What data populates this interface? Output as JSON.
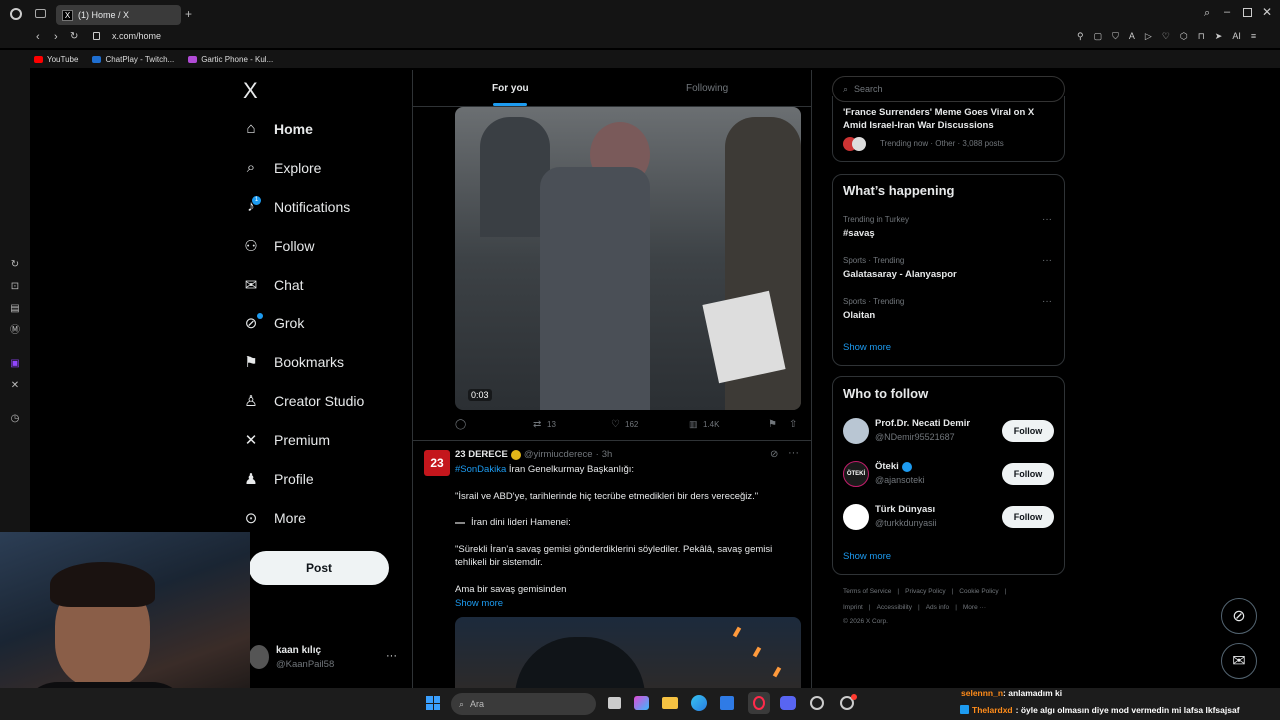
{
  "browser": {
    "tab_title": "(1) Home / X",
    "tab_favicon": "X",
    "url": "x.com/home",
    "ai_label": "AI",
    "bookmarks": [
      {
        "label": "YouTube",
        "color": "#ff0000"
      },
      {
        "label": "ChatPlay - Twitch...",
        "color": "#1f6fd1"
      },
      {
        "label": "Gartic Phone - Kul...",
        "color": "#b14bd6"
      }
    ]
  },
  "nav": {
    "logo": "X",
    "items": [
      {
        "label": "Home",
        "icon": "home-icon"
      },
      {
        "label": "Explore",
        "icon": "search-icon"
      },
      {
        "label": "Notifications",
        "icon": "bell-icon"
      },
      {
        "label": "Follow",
        "icon": "person-add-icon"
      },
      {
        "label": "Chat",
        "icon": "mail-icon"
      },
      {
        "label": "Grok",
        "icon": "grok-icon"
      },
      {
        "label": "Bookmarks",
        "icon": "bookmark-icon"
      },
      {
        "label": "Creator Studio",
        "icon": "creator-icon"
      },
      {
        "label": "Premium",
        "icon": "x-icon"
      },
      {
        "label": "Profile",
        "icon": "person-icon"
      },
      {
        "label": "More",
        "icon": "more-circle-icon"
      }
    ],
    "notifications_badge": "1",
    "post_label": "Post",
    "account_name": "kaan kılıç",
    "account_handle": "@KaanPail58"
  },
  "feed": {
    "tabs": [
      "For you",
      "Following"
    ],
    "active_tab": "For you",
    "tweet1": {
      "video_time": "0:03",
      "retweets": "13",
      "likes": "162",
      "views": "1.4K"
    },
    "tweet2": {
      "avatar_text": "23",
      "name": "23 DERECE",
      "handle": "@yirmiucderece",
      "time": "3h",
      "hashtag": "#SonDakika",
      "lead": "İran Genelkurmay Başkanlığı:",
      "p1": "\"İsrail ve ABD'ye, tarihlerinde hiç tecrübe etmedikleri bir ders vereceğiz.\"",
      "p2": "İran dini lideri Hamenei:",
      "p3": "\"Sürekli İran'a savaş gemisi gönderdiklerini söylediler. Pekâlâ, savaş gemisi tehlikeli bir sistemdir.",
      "p4": "Ama bir savaş gemisinden",
      "show_more": "Show more"
    }
  },
  "right": {
    "search_placeholder": "Search",
    "top_trend": {
      "title": "'France Surrenders' Meme Goes Viral on X Amid Israel-Iran War Discussions",
      "meta": "Trending now · Other · 3,088 posts"
    },
    "whats_happening": {
      "heading": "What’s happening",
      "trends": [
        {
          "meta": "Trending in Turkey",
          "name": "#savaş"
        },
        {
          "meta": "Sports · Trending",
          "name": "Galatasaray - Alanyaspor"
        },
        {
          "meta": "Sports · Trending",
          "name": "Olaitan"
        }
      ],
      "show_more": "Show more"
    },
    "who_to_follow": {
      "heading": "Who to follow",
      "accounts": [
        {
          "name": "Prof.Dr. Necati Demir",
          "handle": "@NDemir95521687"
        },
        {
          "name": "Öteki",
          "handle": "@ajansoteki"
        },
        {
          "name": "Türk Dünyası",
          "handle": "@turkkdunyasii"
        }
      ],
      "follow_label": "Follow",
      "show_more": "Show more"
    },
    "footer": {
      "row1": [
        "Terms of Service",
        "Privacy Policy",
        "Cookie Policy"
      ],
      "row2": [
        "Imprint",
        "Accessibility",
        "Ads info",
        "More ···"
      ],
      "copyright": "© 2026 X Corp."
    }
  },
  "taskbar": {
    "search_placeholder": "Ara"
  },
  "stream_chat": [
    {
      "user": "selennn_n",
      "msg": ": anlamadım ki",
      "color": "#ff8c1a"
    },
    {
      "user": "Thelardxd",
      "msg": ": öyle algı olmasın diye mod vermedin mi lafsa lkfsajsaf",
      "color": "#ff8c1a"
    }
  ]
}
